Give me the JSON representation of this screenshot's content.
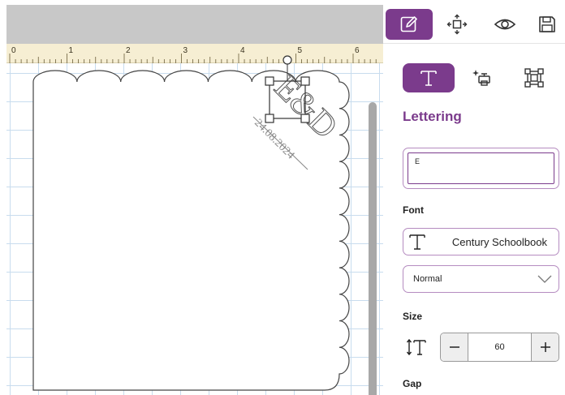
{
  "toolbar": {
    "items": [
      {
        "icon": "edit-icon",
        "active": true
      },
      {
        "icon": "arrange-icon",
        "active": false
      },
      {
        "icon": "preview-eye-icon",
        "active": false
      },
      {
        "icon": "save-icon",
        "active": false
      }
    ]
  },
  "subtabs": {
    "items": [
      {
        "icon": "text-T-icon",
        "active": true
      },
      {
        "icon": "effects-icon",
        "active": false
      },
      {
        "icon": "transform-icon",
        "active": false
      }
    ]
  },
  "panel": {
    "section_title": "Lettering",
    "text_value": "E",
    "font_label": "Font",
    "font_value": "Century Schoolbook",
    "style_value": "Normal",
    "size_label": "Size",
    "size_value": "60",
    "gap_label": "Gap"
  },
  "ruler": {
    "numbers": [
      "0",
      "1",
      "2",
      "3",
      "4",
      "5",
      "6"
    ]
  },
  "canvas": {
    "monogram_text": "E&D",
    "date_text": "24.08.2024"
  },
  "colors": {
    "accent": "#7b3b8c",
    "accent_light": "#b58cc0",
    "ruler_bg": "#f6eed3",
    "top_gray": "#c8c8c8",
    "grid_line": "#c8dcee"
  }
}
